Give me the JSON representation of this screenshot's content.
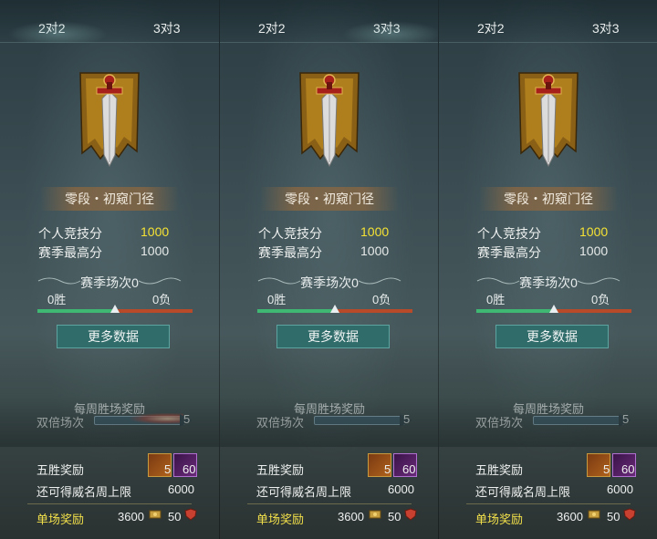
{
  "panels": [
    {
      "tabs": {
        "two_v_two": "2对2",
        "three_v_three": "3对3",
        "active": "two_v_two"
      },
      "rank_name": "零段・初窥门径",
      "personal_score_label": "个人竞技分",
      "personal_score": "1000",
      "season_best_label": "赛季最高分",
      "season_best": "1000",
      "season_matches": "赛季场次0",
      "wins": "0胜",
      "losses": "0负",
      "win_ratio": 0.5,
      "more_data": "更多数据",
      "weekly_reward_title": "每周胜场奖励",
      "double_matches_label": "双倍场次",
      "double_matches_value": "5",
      "five_win_label": "五胜奖励",
      "reward_gold_count": "5",
      "reward_purple_count": "60",
      "fame_cap_label": "还可得威名周上限",
      "fame_cap_value": "6000",
      "single_reward_label": "单场奖励",
      "single_reward_coin": "3600",
      "single_reward_fame": "50"
    },
    {
      "tabs": {
        "two_v_two": "2对2",
        "three_v_three": "3对3",
        "active": "three_v_three"
      },
      "rank_name": "零段・初窥门径",
      "personal_score_label": "个人竞技分",
      "personal_score": "1000",
      "season_best_label": "赛季最高分",
      "season_best": "1000",
      "season_matches": "赛季场次0",
      "wins": "0胜",
      "losses": "0负",
      "win_ratio": 0.5,
      "more_data": "更多数据",
      "weekly_reward_title": "每周胜场奖励",
      "double_matches_label": "双倍场次",
      "double_matches_value": "5",
      "five_win_label": "五胜奖励",
      "reward_gold_count": "5",
      "reward_purple_count": "60",
      "fame_cap_label": "还可得威名周上限",
      "fame_cap_value": "6000",
      "single_reward_label": "单场奖励",
      "single_reward_coin": "3600",
      "single_reward_fame": "50"
    },
    {
      "tabs": {
        "two_v_two": "2对2",
        "three_v_three": "3对3",
        "active": "none"
      },
      "rank_name": "零段・初窥门径",
      "personal_score_label": "个人竞技分",
      "personal_score": "1000",
      "season_best_label": "赛季最高分",
      "season_best": "1000",
      "season_matches": "赛季场次0",
      "wins": "0胜",
      "losses": "0负",
      "win_ratio": 0.5,
      "more_data": "更多数据",
      "weekly_reward_title": "每周胜场奖励",
      "double_matches_label": "双倍场次",
      "double_matches_value": "5",
      "five_win_label": "五胜奖励",
      "reward_gold_count": "5",
      "reward_purple_count": "60",
      "fame_cap_label": "还可得威名周上限",
      "fame_cap_value": "6000",
      "single_reward_label": "单场奖励",
      "single_reward_coin": "3600",
      "single_reward_fame": "50"
    }
  ],
  "colors": {
    "highlight_score": "#f5e234",
    "single_reward_label": "#f2e04a",
    "win_bar": "#3fb873",
    "loss_bar": "#b84a2a",
    "button_bg": "#2f6c6a"
  },
  "icons": [
    "sword-banner-emblem-icon",
    "gold-chest-icon",
    "purple-token-icon",
    "coin-icon",
    "fame-shield-icon"
  ]
}
